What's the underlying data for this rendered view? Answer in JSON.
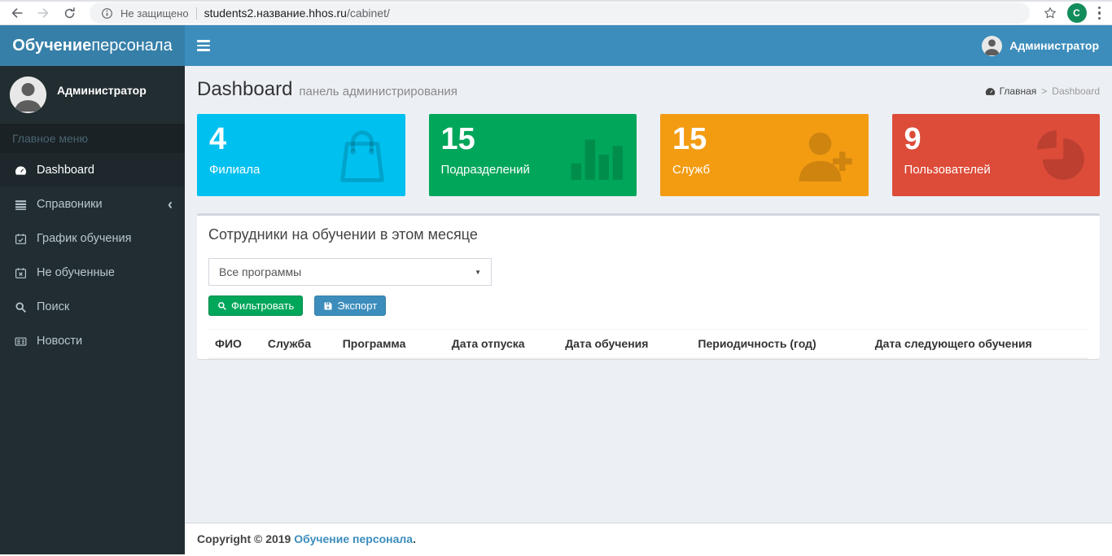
{
  "browser": {
    "security_label": "Не защищено",
    "url_host": "students2.название.hhos.ru",
    "url_path": "/cabinet/",
    "profile_initial": "C"
  },
  "navbar": {
    "brand_bold": "Обучение",
    "brand_regular": "персонала",
    "user_name": "Администратор"
  },
  "sidebar": {
    "user_name": "Администратор",
    "section_header": "Главное меню",
    "items": [
      {
        "name": "dashboard",
        "label": "Dashboard",
        "icon": "dashboard-icon",
        "active": true
      },
      {
        "name": "spravoniki",
        "label": "Справоники",
        "icon": "list-icon",
        "chevron": "‹"
      },
      {
        "name": "grafik-obucheniya",
        "label": "График обучения",
        "icon": "calendar-check-icon"
      },
      {
        "name": "ne-obuchennye",
        "label": "Не обученные",
        "icon": "calendar-times-icon"
      },
      {
        "name": "poisk",
        "label": "Поиск",
        "icon": "search-icon"
      },
      {
        "name": "novosti",
        "label": "Новости",
        "icon": "newspaper-icon"
      }
    ]
  },
  "header": {
    "title": "Dashboard",
    "subtitle": "панель администрирования",
    "breadcrumb_home": "Главная",
    "breadcrumb_sep": ">",
    "breadcrumb_current": "Dashboard"
  },
  "info_boxes": [
    {
      "name": "filiala",
      "value": "4",
      "label": "Филиала",
      "icon": "shopping-bag-icon",
      "color": "#00c0ef"
    },
    {
      "name": "podrazdeleniy",
      "value": "15",
      "label": "Подразделений",
      "icon": "bar-chart-icon",
      "color": "#00a65a"
    },
    {
      "name": "sluzhb",
      "value": "15",
      "label": "Служб",
      "icon": "user-plus-icon",
      "color": "#f39c12"
    },
    {
      "name": "polzovateley",
      "value": "9",
      "label": "Пользователей",
      "icon": "pie-chart-icon",
      "color": "#dd4b39"
    }
  ],
  "training_box": {
    "title": "Сотрудники на обучении в этом месяце",
    "program_select": {
      "selected": "Все программы"
    },
    "filter_button": "Фильтровать",
    "export_button": "Экспорт",
    "table": {
      "columns": [
        "ФИО",
        "Служба",
        "Программа",
        "Дата отпуска",
        "Дата обучения",
        "Периодичность (год)",
        "Дата следующего обучения"
      ],
      "rows": []
    }
  },
  "footer": {
    "copyright": "Copyright © 2019",
    "brand_link": "Обучение персонала",
    "suffix": "."
  },
  "colors": {
    "navbar_bg": "#3c8dbc",
    "logo_bg": "#367fa9",
    "sidebar_bg": "#222d32",
    "sidebar_active_bg": "#1e282c",
    "content_bg": "#ecf0f5",
    "filter_button_bg": "#00a65a",
    "export_button_bg": "#3c8dbc",
    "link_color": "#3c8dbc",
    "profile_badge_bg": "#128c5a"
  }
}
